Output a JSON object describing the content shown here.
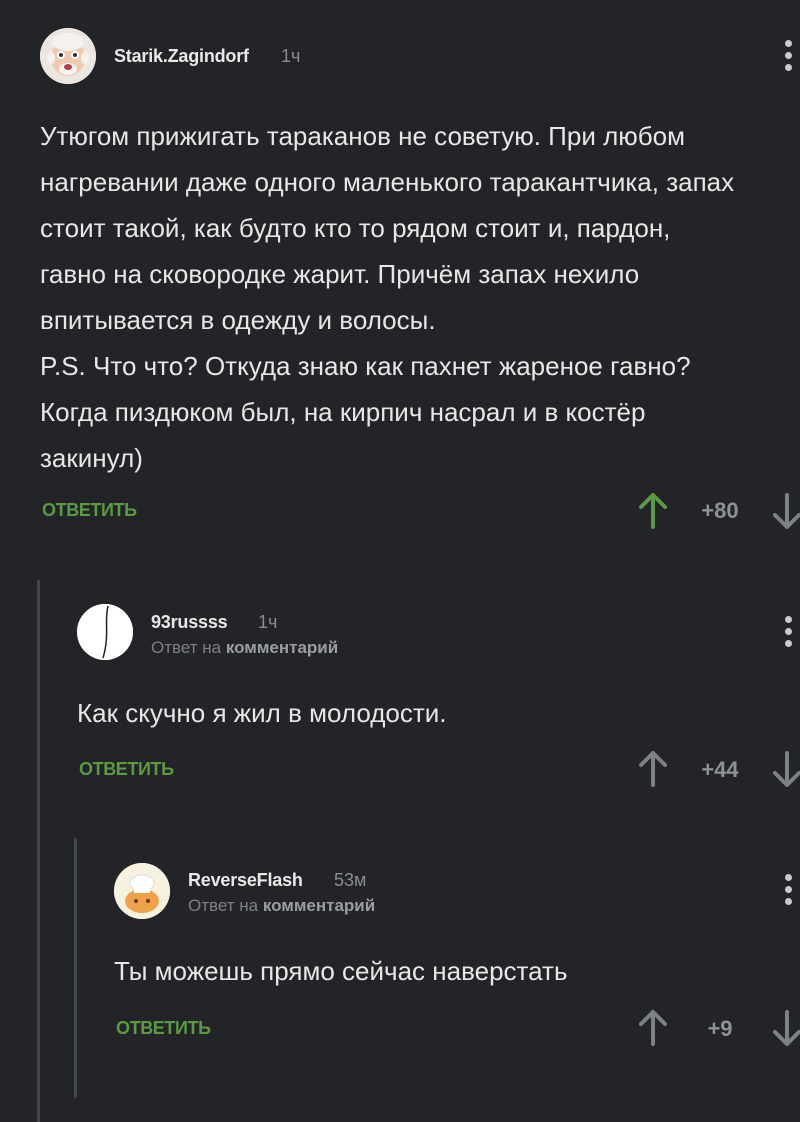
{
  "comments": [
    {
      "author": "Starik.Zagindorf",
      "time": "1ч",
      "text_lines": [
        "Утюгом прижигать тараканов не советую. При любом",
        "нагревании даже одного маленького таракантчика, запах",
        "стоит такой, как будто кто то рядом стоит и, пардон,",
        "гавно на сковородке жарит. Причём запах нехило",
        "впитывается в одежду и волосы.",
        "P.S. Что что? Откуда знаю как пахнет жареное гавно?",
        "Когда пиздюком был, на кирпич насрал и в костёр",
        "закинул)"
      ],
      "reply_label": "ОТВЕТИТЬ",
      "rating": "+80",
      "upvoted": true
    },
    {
      "author": "93russss",
      "time": "1ч",
      "reply_prefix": "Ответ на",
      "reply_target": "комментарий",
      "text": "Как скучно я жил в молодости.",
      "reply_label": "ОТВЕТИТЬ",
      "rating": "+44",
      "upvoted": false
    },
    {
      "author": "ReverseFlash",
      "time": "53м",
      "reply_prefix": "Ответ на",
      "reply_target": "комментарий",
      "text": "Ты можешь прямо сейчас наверстать",
      "reply_label": "ОТВЕТИТЬ",
      "rating": "+9",
      "upvoted": false
    }
  ],
  "colors": {
    "background": "#232427",
    "accent_green": "#5b9a43",
    "muted": "#8e9195",
    "thread_line": "#43464b"
  }
}
